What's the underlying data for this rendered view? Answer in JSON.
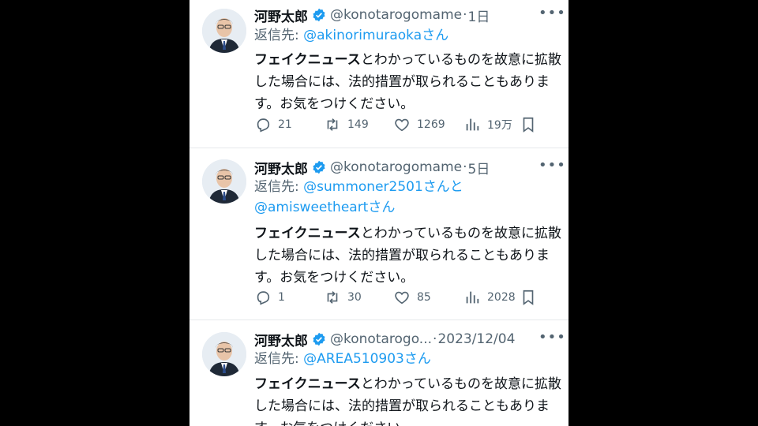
{
  "reply_prefix": "返信先: ",
  "tweets": [
    {
      "name": "河野太郎",
      "handle": "@konotarogomame",
      "separator": "·",
      "time": "1日",
      "reply_to": [
        "@akinorimuraoka"
      ],
      "reply_suffix": "さん",
      "body_bold": "フェイクニュース",
      "body_rest": "とわかっているものを故意に拡散した場合には、法的措置が取られることもあります。お気をつけください。",
      "stats": {
        "replies": "21",
        "reposts": "149",
        "likes": "1269",
        "views": "19万"
      }
    },
    {
      "name": "河野太郎",
      "handle": "@konotarogomame",
      "separator": "·",
      "time": "5日",
      "reply_to": [
        "@summoner2501",
        "@amisweetheart"
      ],
      "reply_mid": "さんと",
      "reply_suffix": "さん",
      "body_bold": "フェイクニュース",
      "body_rest": "とわかっているものを故意に拡散した場合には、法的措置が取られることもあります。お気をつけください。",
      "stats": {
        "replies": "1",
        "reposts": "30",
        "likes": "85",
        "views": "2028"
      }
    },
    {
      "name": "河野太郎",
      "handle": "@konotarogo...",
      "separator": "·",
      "time": "2023/12/04",
      "reply_to": [
        "@AREA510903"
      ],
      "reply_suffix": "さん",
      "body_bold": "フェイクニュース",
      "body_rest": "とわかっているものを故意に拡散した場合には、法的措置が取られることもあります。お気をつけください。"
    }
  ],
  "colors": {
    "link": "#1d9bf0",
    "muted": "#536471",
    "verified": "#1d9bf0"
  },
  "icons": [
    "verified-badge-icon",
    "more-icon",
    "reply-icon",
    "repost-icon",
    "like-icon",
    "views-icon",
    "bookmark-icon"
  ]
}
